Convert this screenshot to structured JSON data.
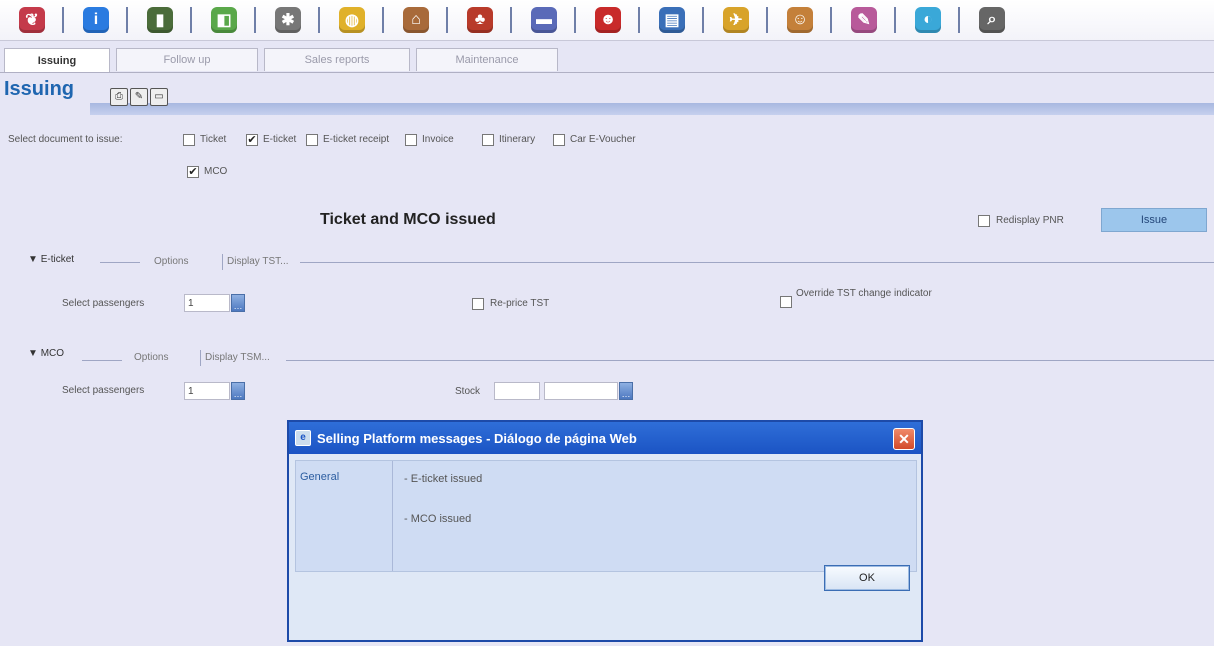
{
  "toolbar": {
    "icons": [
      {
        "name": "profile-icon",
        "glyph": "❦",
        "color": "#c43a4a"
      },
      {
        "name": "info-icon",
        "glyph": "i",
        "color": "#2a7be0"
      },
      {
        "name": "book-icon",
        "glyph": "▮",
        "color": "#4b6c3a"
      },
      {
        "name": "cube-icon",
        "glyph": "◧",
        "color": "#5aa84a"
      },
      {
        "name": "network-icon",
        "glyph": "✱",
        "color": "#777777"
      },
      {
        "name": "globe-pie-icon",
        "glyph": "◍",
        "color": "#e0b12a"
      },
      {
        "name": "house-icon",
        "glyph": "⌂",
        "color": "#a86a3a"
      },
      {
        "name": "chair-icon",
        "glyph": "♣",
        "color": "#b83a2a"
      },
      {
        "name": "car-icon",
        "glyph": "▬",
        "color": "#5a6ab8"
      },
      {
        "name": "agent-icon",
        "glyph": "☻",
        "color": "#c82a2a"
      },
      {
        "name": "documents-icon",
        "glyph": "▤",
        "color": "#3a6fb8"
      },
      {
        "name": "airplane-icon",
        "glyph": "✈",
        "color": "#d8a32a"
      },
      {
        "name": "person-icon",
        "glyph": "☺",
        "color": "#c4803a"
      },
      {
        "name": "chart-icon",
        "glyph": "✎",
        "color": "#b85a9a"
      },
      {
        "name": "web-icon",
        "glyph": "◐",
        "color": "#3aa8d8"
      },
      {
        "name": "search-icon",
        "glyph": "⌕",
        "color": "#666666"
      }
    ]
  },
  "tabs": [
    {
      "label": "Issuing",
      "active": true
    },
    {
      "label": "Follow up",
      "active": false
    },
    {
      "label": "Sales reports",
      "active": false
    },
    {
      "label": "Maintenance",
      "active": false
    }
  ],
  "page": {
    "title": "Issuing"
  },
  "form": {
    "select_doc_label": "Select document to issue:",
    "doc_options": [
      {
        "label": "Ticket",
        "checked": false
      },
      {
        "label": "E-ticket",
        "checked": true
      },
      {
        "label": "E-ticket receipt",
        "checked": false
      },
      {
        "label": "Invoice",
        "checked": false
      },
      {
        "label": "Itinerary",
        "checked": false
      },
      {
        "label": "Car E-Voucher",
        "checked": false
      },
      {
        "label": "MCO",
        "checked": true
      }
    ],
    "status_message": "Ticket and MCO issued",
    "redisplay_label": "Redisplay PNR",
    "issue_button": "Issue",
    "eticket": {
      "section": "E-ticket",
      "options_tab": "Options",
      "display_tab": "Display TST...",
      "select_passengers_label": "Select passengers",
      "passengers_value": "1",
      "reprice_label": "Re-price TST",
      "override_label": "Override TST change indicator"
    },
    "mco": {
      "section": "MCO",
      "options_tab": "Options",
      "display_tab": "Display TSM...",
      "select_passengers_label": "Select passengers",
      "passengers_value": "1",
      "stock_label": "Stock"
    }
  },
  "dialog": {
    "title": "Selling Platform messages - Diálogo de página Web",
    "category": "General",
    "messages": [
      "- E-ticket issued",
      "- MCO issued"
    ],
    "ok_label": "OK"
  }
}
